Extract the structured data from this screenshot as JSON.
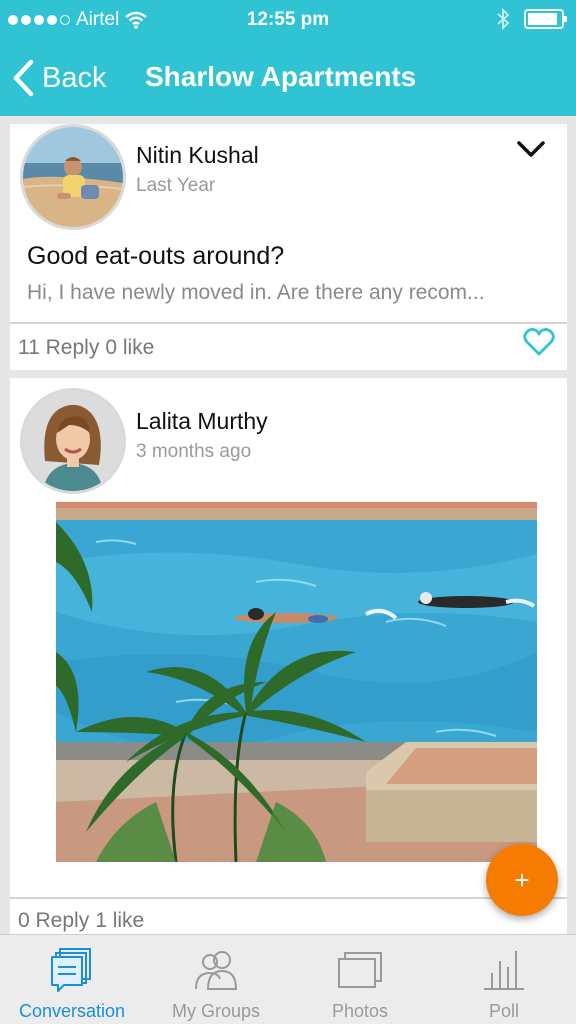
{
  "status_bar": {
    "carrier": "Airtel",
    "time": "12:55 pm",
    "signal_icon": "signal-dots-icon",
    "wifi_icon": "wifi-icon",
    "bluetooth_icon": "bluetooth-icon",
    "battery_icon": "battery-icon",
    "battery_level": 0.9
  },
  "nav": {
    "back_label": "Back",
    "title": "Sharlow Apartments"
  },
  "posts": [
    {
      "author": "Nitin Kushal",
      "time": "Last Year",
      "title": "Good eat-outs around?",
      "excerpt": "Hi, I have newly moved in. Are there any recom...",
      "reply_count": "11 Reply",
      "like_count": "0 like"
    },
    {
      "author": "Lalita Murthy",
      "time": "3 months ago",
      "reply_count": "0 Reply",
      "like_count": "1 like"
    }
  ],
  "fab": {
    "label": "+"
  },
  "tabs": [
    {
      "label": "Conversation",
      "icon": "conversation-icon",
      "active": true
    },
    {
      "label": "My Groups",
      "icon": "groups-icon",
      "active": false
    },
    {
      "label": "Photos",
      "icon": "photos-icon",
      "active": false
    },
    {
      "label": "Poll",
      "icon": "poll-icon",
      "active": false
    }
  ],
  "colors": {
    "header": "#2fc3d4",
    "fab": "#f57c00",
    "active_tab": "#1a8fd9",
    "heart": "#2fc3d4"
  }
}
